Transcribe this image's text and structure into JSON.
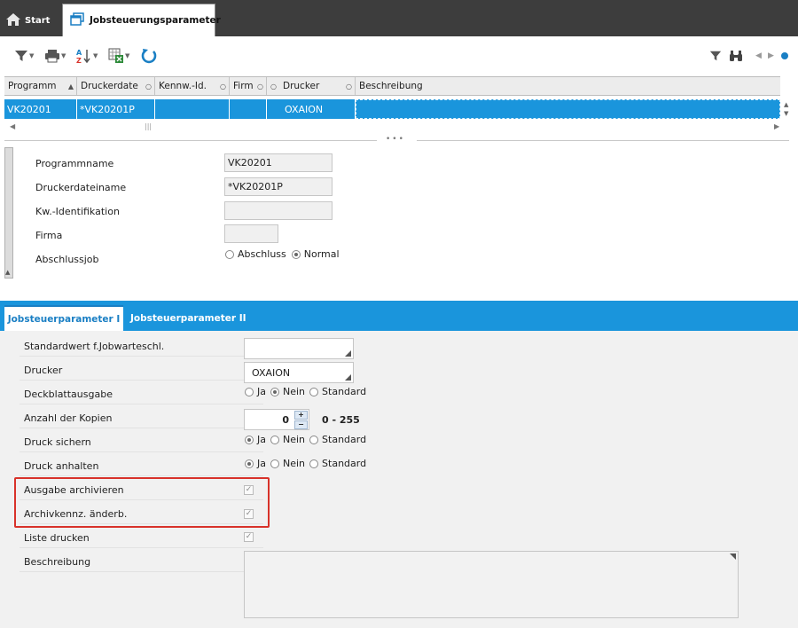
{
  "tabs": {
    "start": "Start",
    "active": "Jobsteuerungsparameter"
  },
  "grid": {
    "headers": [
      "Programm",
      "Druckerdate",
      "Kennw.-Id.",
      "Firm",
      "Drucker",
      "Beschreibung"
    ],
    "row": [
      "VK20201",
      "*VK20201P",
      "",
      "",
      "OXAION",
      ""
    ]
  },
  "form": {
    "programmname_label": "Programmname",
    "programmname_value": "VK20201",
    "druckerdateiname_label": "Druckerdateiname",
    "druckerdateiname_value": "*VK20201P",
    "kw_label": "Kw.-Identifikation",
    "kw_value": "",
    "firma_label": "Firma",
    "firma_value": "",
    "abschlussjob_label": "Abschlussjob",
    "abschlussjob_opt1": "Abschluss",
    "abschlussjob_opt2": "Normal",
    "abschlussjob_selected": "Normal"
  },
  "subtabs": {
    "tab1": "Jobsteuerparameter I",
    "tab2": "Jobsteuerparameter II"
  },
  "lower": {
    "standardwert_label": "Standardwert f.Jobwarteschl.",
    "standardwert_value": "",
    "drucker_label": "Drucker",
    "drucker_value": "OXAION",
    "deckblatt_label": "Deckblattausgabe",
    "kopien_label": "Anzahl der Kopien",
    "kopien_value": "0",
    "kopien_range": "0 - 255",
    "druck_sichern_label": "Druck sichern",
    "druck_anhalten_label": "Druck anhalten",
    "ausgabe_archivieren_label": "Ausgabe archivieren",
    "archivkennz_label": "Archivkennz. änderb.",
    "liste_drucken_label": "Liste drucken",
    "beschreibung_label": "Beschreibung",
    "beschreibung_value": "",
    "opt_ja": "Ja",
    "opt_nein": "Nein",
    "opt_standard": "Standard",
    "deckblatt_selected": "Nein",
    "druck_sichern_selected": "Ja",
    "druck_anhalten_selected": "Ja",
    "ausgabe_archivieren_checked": true,
    "archivkennz_checked": true,
    "liste_drucken_checked": true
  },
  "colors": {
    "accent": "#1a95dc",
    "tabbar": "#3d3d3d",
    "highlight": "#d8322a"
  },
  "icons": [
    "home-icon",
    "window-icon",
    "filter-icon",
    "print-icon",
    "sort-az-icon",
    "excel-export-icon",
    "refresh-icon",
    "filter-right-icon",
    "binoculars-icon",
    "prev-icon",
    "next-icon",
    "status-dot-icon"
  ]
}
